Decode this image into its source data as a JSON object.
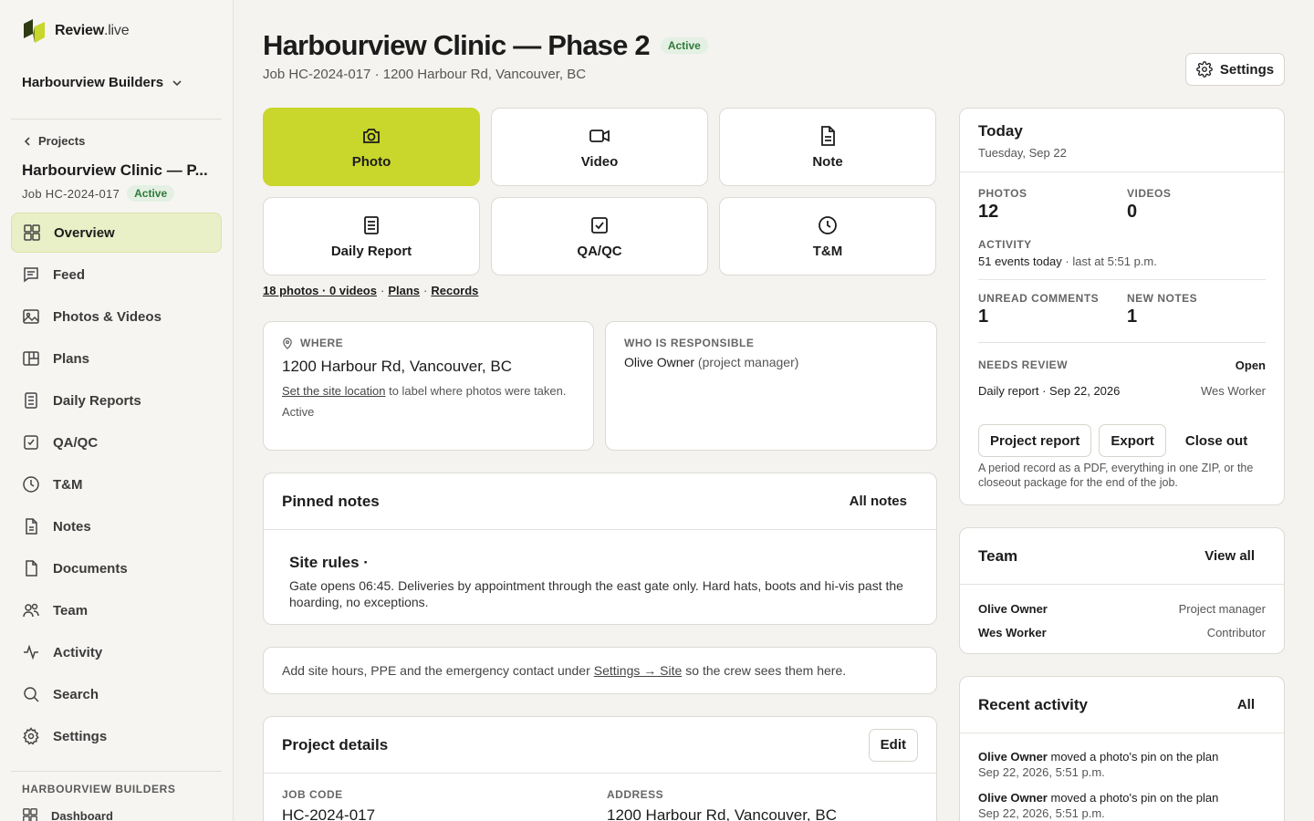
{
  "brand": {
    "name": "Review",
    "tld": ".live"
  },
  "org": {
    "name": "Harbourview Builders"
  },
  "sidebar": {
    "back_label": "Projects",
    "project_name": "Harbourview Clinic — P...",
    "project_code": "Job HC-2024-017",
    "project_status": "Active",
    "items": [
      {
        "label": "Overview",
        "icon": "grid-icon"
      },
      {
        "label": "Feed",
        "icon": "message-icon"
      },
      {
        "label": "Photos & Videos",
        "icon": "image-icon"
      },
      {
        "label": "Plans",
        "icon": "map-icon"
      },
      {
        "label": "Daily Reports",
        "icon": "report-icon"
      },
      {
        "label": "QA/QC",
        "icon": "check-square-icon"
      },
      {
        "label": "T&M",
        "icon": "clock-icon"
      },
      {
        "label": "Notes",
        "icon": "document-icon"
      },
      {
        "label": "Documents",
        "icon": "file-icon"
      },
      {
        "label": "Team",
        "icon": "users-icon"
      },
      {
        "label": "Activity",
        "icon": "pulse-icon"
      },
      {
        "label": "Search",
        "icon": "search-icon"
      },
      {
        "label": "Settings",
        "icon": "gear-icon"
      }
    ],
    "org_section_label": "HARBOURVIEW BUILDERS",
    "org_dashboard_label": "Dashboard"
  },
  "header": {
    "title": "Harbourview Clinic — Phase 2",
    "status": "Active",
    "subtitle": "Job HC-2024-017 · 1200 Harbour Rd, Vancouver, BC",
    "settings_label": "Settings"
  },
  "actions": {
    "photo": "Photo",
    "video": "Video",
    "note": "Note",
    "daily_report": "Daily Report",
    "qaqc": "QA/QC",
    "tm": "T&M"
  },
  "quick_links": {
    "media": "18 photos · 0 videos",
    "plans": "Plans",
    "records": "Records",
    "sep": "·"
  },
  "where": {
    "label": "WHERE",
    "address": "1200 Harbour Rd, Vancouver, BC",
    "hint_link": "Set the site location",
    "hint_rest": " to label where photos were taken.",
    "status": "Active"
  },
  "who": {
    "label": "WHO IS RESPONSIBLE",
    "name": "Olive Owner",
    "role": "(project manager)"
  },
  "pinned": {
    "title": "Pinned notes",
    "all_label": "All notes",
    "note_title": "Site rules ·",
    "note_body": "Gate opens 06:45. Deliveries by appointment through the east gate only. Hard hats, boots and hi-vis past the hoarding, no exceptions."
  },
  "tip": {
    "pre": "Add site hours, PPE and the emergency contact under",
    "link": "Settings → Site",
    "post": "so the crew sees them here."
  },
  "details": {
    "title": "Project details",
    "edit_label": "Edit",
    "job_code_label": "JOB CODE",
    "job_code": "HC-2024-017",
    "address_label": "ADDRESS",
    "address": "1200 Harbour Rd, Vancouver, BC"
  },
  "today": {
    "title": "Today",
    "date": "Tuesday, Sep 22",
    "photos_label": "PHOTOS",
    "photos": "12",
    "videos_label": "VIDEOS",
    "videos": "0",
    "activity_label": "ACTIVITY",
    "activity_count": "51 events today",
    "activity_last": "· last at 5:51 p.m.",
    "unread_label": "UNREAD COMMENTS",
    "unread": "1",
    "new_notes_label": "NEW NOTES",
    "new_notes": "1",
    "needs_review_label": "NEEDS REVIEW",
    "open_label": "Open",
    "review_item": "Daily report · Sep 22, 2026",
    "review_who": "Wes Worker",
    "project_report": "Project report",
    "export": "Export",
    "close_out": "Close out",
    "hint": "A period record as a PDF, everything in one ZIP, or the closeout package for the end of the job."
  },
  "team": {
    "title": "Team",
    "view_all": "View all",
    "members": [
      {
        "name": "Olive Owner",
        "role": "Project manager"
      },
      {
        "name": "Wes Worker",
        "role": "Contributor"
      }
    ]
  },
  "recent": {
    "title": "Recent activity",
    "all_label": "All",
    "items": [
      {
        "who": "Olive Owner",
        "what": " moved a photo's pin on the plan",
        "time": "Sep 22, 2026, 5:51 p.m."
      },
      {
        "who": "Olive Owner",
        "what": " moved a photo's pin on the plan",
        "time": "Sep 22, 2026, 5:51 p.m."
      }
    ]
  },
  "colors": {
    "accent": "#c9d62b",
    "active_nav": "#e9efc6",
    "badge_bg": "#e3f0e3",
    "badge_fg": "#2f7a3a"
  }
}
